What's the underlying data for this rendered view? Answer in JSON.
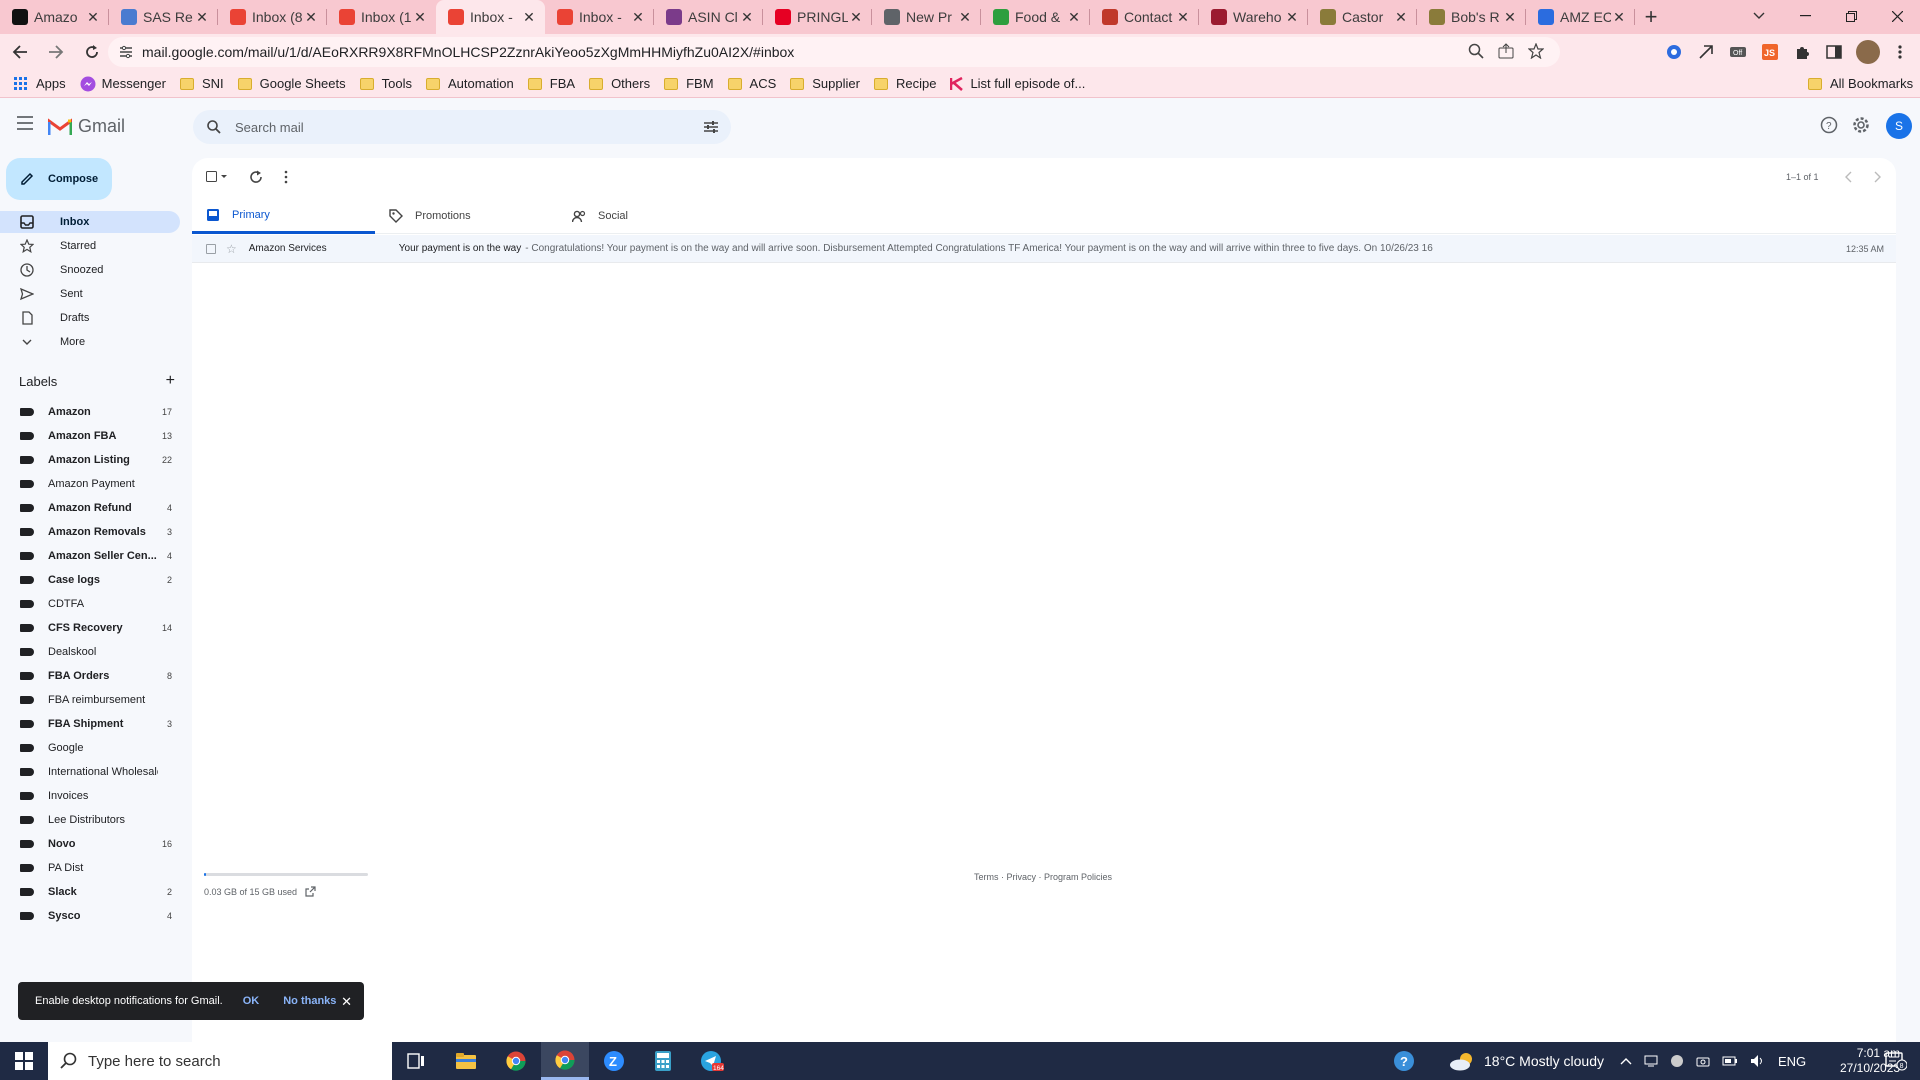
{
  "browser": {
    "tabs": [
      {
        "title": "Amazo",
        "favicon": "amazon-icon",
        "color": "#111111"
      },
      {
        "title": "SAS Re",
        "favicon": "sas-icon",
        "color": "#4a7bd0"
      },
      {
        "title": "Inbox (8",
        "favicon": "gmail-icon",
        "color": "#ea4335"
      },
      {
        "title": "Inbox (1",
        "favicon": "gmail-icon",
        "color": "#ea4335"
      },
      {
        "title": "Inbox -",
        "favicon": "gmail-icon",
        "color": "#ea4335",
        "active": true
      },
      {
        "title": "Inbox -",
        "favicon": "gmail-icon",
        "color": "#ea4335"
      },
      {
        "title": "ASIN Cl",
        "favicon": "asin-icon",
        "color": "#7b3b8a"
      },
      {
        "title": "PRINGL",
        "favicon": "pinterest-icon",
        "color": "#e60023"
      },
      {
        "title": "New Pr",
        "favicon": "globe-icon",
        "color": "#5f6368"
      },
      {
        "title": "Food &",
        "favicon": "food-icon",
        "color": "#2e9e3e"
      },
      {
        "title": "Contact",
        "favicon": "contact-icon",
        "color": "#c0392b"
      },
      {
        "title": "Wareho",
        "favicon": "wareho-icon",
        "color": "#9b1b30"
      },
      {
        "title": "Castor",
        "favicon": "castor-icon",
        "color": "#8a7b3a"
      },
      {
        "title": "Bob's R",
        "favicon": "bobs-icon",
        "color": "#8a7b3a"
      },
      {
        "title": "AMZ EC",
        "favicon": "amz-icon",
        "color": "#2b6cdf"
      }
    ],
    "url": "mail.google.com/mail/u/1/d/AEoRXRR9X8RFMnOLHCSP2ZznrAkiYeoo5zXgMmHHMiyfhZu0AI2X/#inbox",
    "bookmarks": [
      "Apps",
      "Messenger",
      "SNI",
      "Google Sheets",
      "Tools",
      "Automation",
      "FBA",
      "Others",
      "FBM",
      "ACS",
      "Supplier",
      "Recipe",
      "List full episode of..."
    ],
    "all_bookmarks": "All Bookmarks"
  },
  "gmail": {
    "brand": "Gmail",
    "search_placeholder": "Search mail",
    "avatar_letter": "S",
    "compose": "Compose",
    "nav": [
      {
        "label": "Inbox",
        "icon": "inbox-icon",
        "active": true
      },
      {
        "label": "Starred",
        "icon": "star-icon"
      },
      {
        "label": "Snoozed",
        "icon": "clock-icon"
      },
      {
        "label": "Sent",
        "icon": "send-icon"
      },
      {
        "label": "Drafts",
        "icon": "draft-icon"
      },
      {
        "label": "More",
        "icon": "chevron-down-icon"
      }
    ],
    "labels_title": "Labels",
    "labels": [
      {
        "name": "Amazon",
        "count": "17",
        "bold": true
      },
      {
        "name": "Amazon FBA",
        "count": "13",
        "bold": true
      },
      {
        "name": "Amazon Listing",
        "count": "22",
        "bold": true
      },
      {
        "name": "Amazon Payment",
        "count": "",
        "bold": false
      },
      {
        "name": "Amazon Refund",
        "count": "4",
        "bold": true
      },
      {
        "name": "Amazon Removals",
        "count": "3",
        "bold": true
      },
      {
        "name": "Amazon Seller Cen...",
        "count": "4",
        "bold": true
      },
      {
        "name": "Case logs",
        "count": "2",
        "bold": true
      },
      {
        "name": "CDTFA",
        "count": "",
        "bold": false
      },
      {
        "name": "CFS Recovery",
        "count": "14",
        "bold": true
      },
      {
        "name": "Dealskool",
        "count": "",
        "bold": false
      },
      {
        "name": "FBA Orders",
        "count": "8",
        "bold": true
      },
      {
        "name": "FBA reimbursement",
        "count": "",
        "bold": false
      },
      {
        "name": "FBA Shipment",
        "count": "3",
        "bold": true
      },
      {
        "name": "Google",
        "count": "",
        "bold": false
      },
      {
        "name": "International Wholesale",
        "count": "",
        "bold": false
      },
      {
        "name": "Invoices",
        "count": "",
        "bold": false
      },
      {
        "name": "Lee Distributors",
        "count": "",
        "bold": false
      },
      {
        "name": "Novo",
        "count": "16",
        "bold": true
      },
      {
        "name": "PA Dist",
        "count": "",
        "bold": false
      },
      {
        "name": "Slack",
        "count": "2",
        "bold": true
      },
      {
        "name": "Sysco",
        "count": "4",
        "bold": true
      }
    ],
    "pagination": "1–1 of 1",
    "tabs": [
      {
        "label": "Primary",
        "icon": "inbox-icon",
        "active": true
      },
      {
        "label": "Promotions",
        "icon": "tag-icon"
      },
      {
        "label": "Social",
        "icon": "people-icon"
      }
    ],
    "email": {
      "sender": "Amazon Services",
      "subject": "Your payment is on the way",
      "snippet": "- Congratulations! Your payment is on the way and will arrive soon. Disbursement Attempted Congratulations TF America! Your payment is on the way and will arrive within three to five days. On 10/26/23 16",
      "time": "12:35 AM"
    },
    "storage_text": "0.03 GB of 15 GB used",
    "storage_fraction": 0.002,
    "footer": "Terms · Privacy · Program Policies",
    "snackbar": {
      "text": "Enable desktop notifications for Gmail.",
      "ok": "OK",
      "no": "No thanks"
    }
  },
  "taskbar": {
    "search_placeholder": "Type here to search",
    "weather": "18°C  Mostly cloudy",
    "language": "ENG",
    "time": "7:01 am",
    "date": "27/10/2023",
    "notification_count": "8",
    "telegram_badge": "164"
  }
}
